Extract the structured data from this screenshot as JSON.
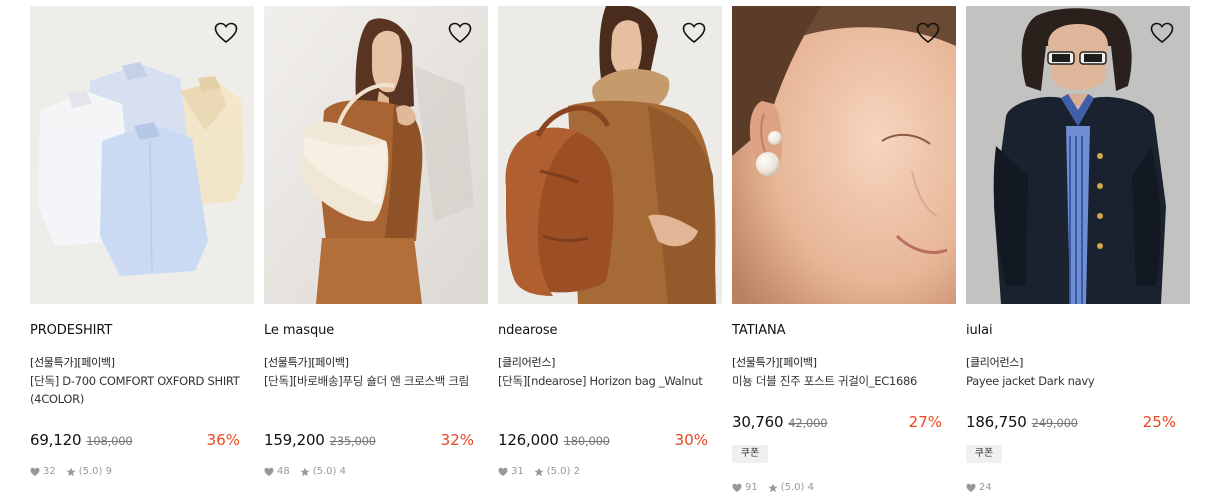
{
  "products": [
    {
      "brand": "PRODESHIRT",
      "badge": "[선물특가][페이백]",
      "title": "[단독] D-700 COMFORT OXFORD SHIRT (4COLOR)",
      "price": "69,120",
      "original_price": "108,000",
      "discount": "36%",
      "coupon": null,
      "likes": "32",
      "rating": "(5.0) 9",
      "thumbnail_icon": "shirts-photo"
    },
    {
      "brand": "Le masque",
      "badge": "[선물특가][페이백]",
      "title": "[단독][바로배송]푸딩 숄더 앤 크로스백 크림",
      "price": "159,200",
      "original_price": "235,000",
      "discount": "32%",
      "coupon": null,
      "likes": "48",
      "rating": "(5.0) 4",
      "thumbnail_icon": "shoulder-bag-photo"
    },
    {
      "brand": "ndearose",
      "badge": "[클리어런스]",
      "title": "[단독][ndearose] Horizon bag _Walnut",
      "price": "126,000",
      "original_price": "180,000",
      "discount": "30%",
      "coupon": null,
      "likes": "31",
      "rating": "(5.0) 2",
      "thumbnail_icon": "leather-bag-photo"
    },
    {
      "brand": "TATIANA",
      "badge": "[선물특가][페이백]",
      "title": "미뇽 더블 진주 포스트 귀걸이_EC1686",
      "price": "30,760",
      "original_price": "42,000",
      "discount": "27%",
      "coupon": "쿠폰",
      "likes": "91",
      "rating": "(5.0) 4",
      "thumbnail_icon": "pearl-earring-photo"
    },
    {
      "brand": "iulai",
      "badge": "[클리어런스]",
      "title": "Payee jacket Dark navy",
      "price": "186,750",
      "original_price": "249,000",
      "discount": "25%",
      "coupon": "쿠폰",
      "likes": "24",
      "rating": null,
      "thumbnail_icon": "navy-jacket-photo"
    }
  ],
  "colors": {
    "discount": "#e8471e",
    "text": "#111111",
    "muted": "#999999",
    "coupon_bg": "#f0f0f0"
  },
  "icons": {
    "wishlist": "heart-outline-icon",
    "likes": "heart-filled-icon",
    "rating": "star-icon"
  }
}
